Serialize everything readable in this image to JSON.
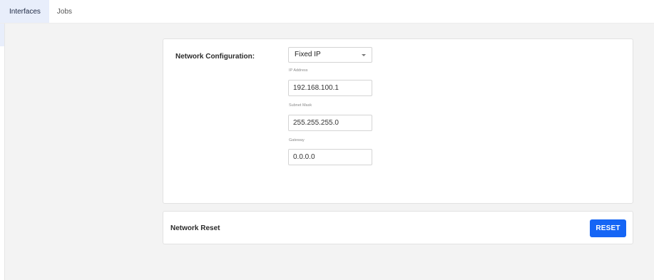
{
  "tabs": [
    {
      "label": "Interfaces",
      "active": true
    },
    {
      "label": "Jobs",
      "active": false
    }
  ],
  "network_config": {
    "label": "Network Configuration:",
    "mode_selected": "Fixed IP",
    "fields": [
      {
        "label": "IP Address",
        "value": "192.168.100.1"
      },
      {
        "label": "Subnet Mask",
        "value": "255.255.255.0"
      },
      {
        "label": "Gateway",
        "value": "0.0.0.0"
      }
    ]
  },
  "network_reset": {
    "label": "Network Reset",
    "button_label": "RESET"
  },
  "colors": {
    "accent": "#1565f5",
    "active_tab_bg": "#e8eefb",
    "page_bg": "#f3f3f3"
  },
  "icons": {
    "dropdown": "chevron-down-icon"
  }
}
